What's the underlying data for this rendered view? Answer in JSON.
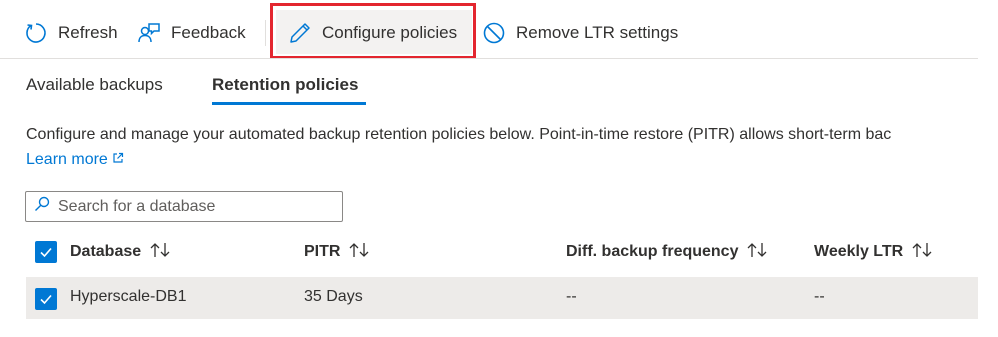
{
  "toolbar": {
    "refresh_label": "Refresh",
    "feedback_label": "Feedback",
    "configure_label": "Configure policies",
    "remove_label": "Remove LTR settings"
  },
  "tabs": [
    {
      "label": "Available backups",
      "active": false
    },
    {
      "label": "Retention policies",
      "active": true
    }
  ],
  "description": "Configure and manage your automated backup retention policies below. Point-in-time restore (PITR) allows short-term bac",
  "learn_more": "Learn more",
  "search": {
    "placeholder": "Search for a database"
  },
  "table": {
    "columns": [
      "Database",
      "PITR",
      "Diff. backup frequency",
      "Weekly LTR"
    ],
    "rows": [
      {
        "database": "Hyperscale-DB1",
        "pitr": "35 Days",
        "diff": "--",
        "weekly": "--",
        "selected": true
      }
    ]
  },
  "colors": {
    "accent": "#0078d4",
    "highlight": "#e3262f",
    "row_bg": "#edebe9"
  },
  "icons": [
    "refresh-icon",
    "feedback-icon",
    "pencil-icon",
    "block-icon",
    "external-link-icon",
    "search-icon",
    "sort-icon",
    "checkbox-icon"
  ]
}
